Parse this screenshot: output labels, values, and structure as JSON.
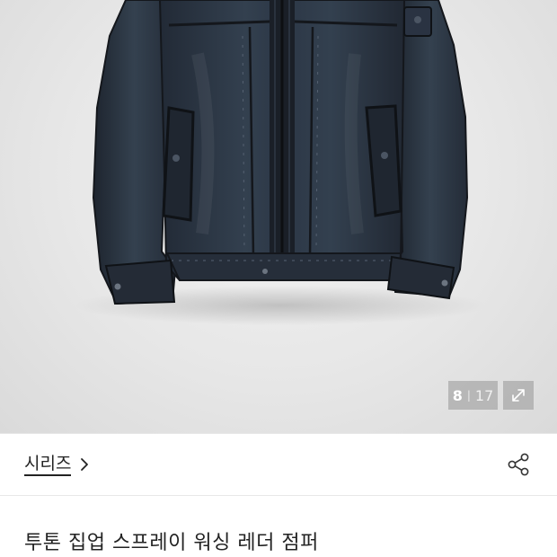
{
  "gallery": {
    "current_index": "8",
    "separator": "|",
    "total_count": "17",
    "image_alt": "투톤 집업 스프레이 워싱 레더 점퍼",
    "expand_icon": "expand-icon"
  },
  "series": {
    "label": "시리즈",
    "chevron_icon": "chevron-right-icon"
  },
  "share": {
    "icon": "share-icon"
  },
  "product": {
    "title": "투톤 집업 스프레이 워싱 레더 점퍼"
  },
  "colors": {
    "jacket_navy": "#2a3342",
    "jacket_trim": "#15181d",
    "background": "#e7e7e7"
  }
}
